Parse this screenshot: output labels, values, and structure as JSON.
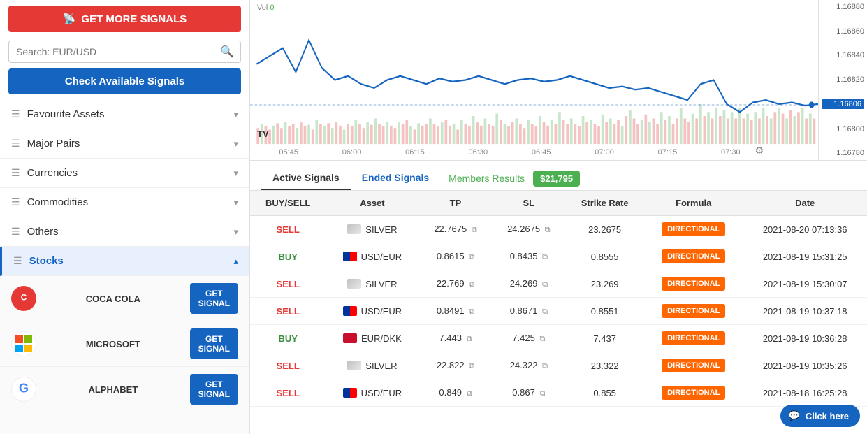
{
  "sidebar": {
    "get_more_signals": "GET MORE SIGNALS",
    "search_placeholder": "Search: EUR/USD",
    "check_signals": "Check Available Signals",
    "nav_items": [
      {
        "id": "favourite",
        "label": "Favourite Assets"
      },
      {
        "id": "major",
        "label": "Major Pairs"
      },
      {
        "id": "currencies",
        "label": "Currencies"
      },
      {
        "id": "commodities",
        "label": "Commodities"
      },
      {
        "id": "others",
        "label": "Others"
      },
      {
        "id": "stocks",
        "label": "Stocks",
        "active": true
      }
    ],
    "stocks": [
      {
        "name": "COCA\nCOLA",
        "btn": "GET\nSIGNAL",
        "color": "#e53935",
        "initial": "C"
      },
      {
        "name": "MICROSOFT",
        "btn": "GET\nSIGNAL",
        "color": "#0078d4",
        "initial": "M"
      },
      {
        "name": "ALPHABET",
        "btn": "GET\nSIGNAL",
        "color": "#4285f4",
        "initial": "G"
      }
    ]
  },
  "chart": {
    "vol_label": "Vol",
    "vol_value": "0",
    "price_levels": [
      "1.16880",
      "1.16860",
      "1.16840",
      "1.16820",
      "1.16806",
      "1.16800",
      "1.16780"
    ],
    "highlighted_price": "1.16806",
    "times": [
      "05:45",
      "06:00",
      "06:15",
      "06:30",
      "06:45",
      "07:00",
      "07:15",
      "07:30"
    ]
  },
  "tabs": {
    "active": "Active Signals",
    "ended": "Ended Signals",
    "members": "Members Results",
    "amount": "$21,795"
  },
  "table": {
    "headers": [
      "BUY/SELL",
      "Asset",
      "TP",
      "SL",
      "Strike Rate",
      "Formula",
      "Date"
    ],
    "rows": [
      {
        "action": "SELL",
        "asset": "SILVER",
        "tp": "22.7675",
        "sl": "24.2675",
        "strike": "23.2675",
        "formula": "DIRECTIONAL",
        "date": "2021-08-20 07:13:36",
        "type": "silver"
      },
      {
        "action": "BUY",
        "asset": "USD/EUR",
        "tp": "0.8615",
        "sl": "0.8435",
        "strike": "0.8555",
        "formula": "DIRECTIONAL",
        "date": "2021-08-19 15:31:25",
        "type": "usdeur"
      },
      {
        "action": "SELL",
        "asset": "SILVER",
        "tp": "22.769",
        "sl": "24.269",
        "strike": "23.269",
        "formula": "DIRECTIONAL",
        "date": "2021-08-19 15:30:07",
        "type": "silver"
      },
      {
        "action": "SELL",
        "asset": "USD/EUR",
        "tp": "0.8491",
        "sl": "0.8671",
        "strike": "0.8551",
        "formula": "DIRECTIONAL",
        "date": "2021-08-19 10:37:18",
        "type": "usdeur"
      },
      {
        "action": "BUY",
        "asset": "EUR/DKK",
        "tp": "7.443",
        "sl": "7.425",
        "strike": "7.437",
        "formula": "DIRECTIONAL",
        "date": "2021-08-19 10:36:28",
        "type": "eurdkk"
      },
      {
        "action": "SELL",
        "asset": "SILVER",
        "tp": "22.822",
        "sl": "24.322",
        "strike": "23.322",
        "formula": "DIRECTIONAL",
        "date": "2021-08-19 10:35:26",
        "type": "silver"
      },
      {
        "action": "SELL",
        "asset": "USD/EUR",
        "tp": "0.849",
        "sl": "0.867",
        "strike": "0.855",
        "formula": "DIRECTIONAL",
        "date": "2021-08-18 16:25:28",
        "type": "usdeur"
      }
    ]
  },
  "chat_btn": "Click here",
  "colors": {
    "blue": "#1565c0",
    "red": "#e53935",
    "orange": "#ff6600",
    "green": "#4caf50"
  }
}
